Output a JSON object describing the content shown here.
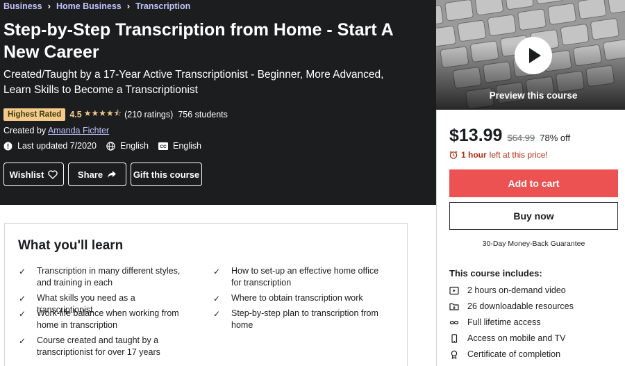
{
  "breadcrumb": [
    "Business",
    "Home Business",
    "Transcription"
  ],
  "course": {
    "title": "Step-by-Step Transcription from Home - Start A New Career",
    "subtitle": "Created/Taught by a 17-Year Active Transcriptionist - Beginner, More Advanced, Learn Skills to Become a Transcriptionist",
    "badge": "Highest Rated",
    "rating": "4.5",
    "stars": "★★★★⯪",
    "ratings_count": "(210 ratings)",
    "students": "756 students",
    "created_by_label": "Created by",
    "instructor": "Amanda Fichter",
    "last_updated": "Last updated 7/2020",
    "language": "English",
    "captions": "English"
  },
  "actions": {
    "wishlist": "Wishlist",
    "share": "Share",
    "gift": "Gift this course"
  },
  "preview": {
    "label": "Preview this course"
  },
  "purchase": {
    "price": "$13.99",
    "original_price": "$64.99",
    "discount": "78% off",
    "time_left_bold": "1 hour",
    "time_left_rest": "left at this price!",
    "add_to_cart": "Add to cart",
    "buy_now": "Buy now",
    "guarantee": "30-Day Money-Back Guarantee",
    "includes_title": "This course includes:",
    "includes": [
      {
        "icon": "video-icon",
        "text": "2 hours on-demand video"
      },
      {
        "icon": "folder-icon",
        "text": "26 downloadable resources"
      },
      {
        "icon": "infinity-icon",
        "text": "Full lifetime access"
      },
      {
        "icon": "mobile-icon",
        "text": "Access on mobile and TV"
      },
      {
        "icon": "certificate-icon",
        "text": "Certificate of completion"
      }
    ]
  },
  "learn": {
    "title": "What you'll learn",
    "items": [
      "Transcription in many different styles, and training in each",
      "How to set-up an effective home office for transcription",
      "What skills you need as a transcriptionist",
      "Where to obtain transcription work",
      "Work-life balance when working from home in transcription",
      "Step-by-step plan to transcription from home",
      "Course created and taught by a transcriptionist for over 17 years"
    ]
  },
  "colors": {
    "hero_bg": "#1c1d1f",
    "accent_link": "#c0c4fc",
    "star": "#f3ca8c",
    "cart": "#ec5252",
    "timer": "#b32d0f"
  }
}
